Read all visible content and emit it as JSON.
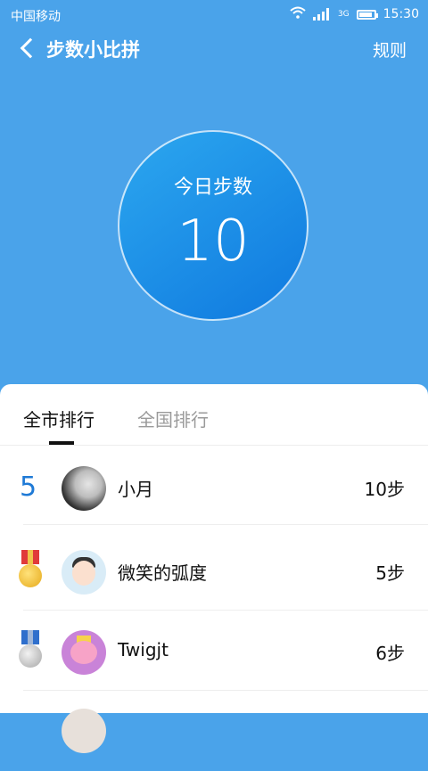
{
  "status_bar": {
    "carrier": "中国移动",
    "network": "3G",
    "time": "15:30"
  },
  "header": {
    "title": "步数小比拼",
    "rules_label": "规则"
  },
  "today": {
    "label": "今日步数",
    "value": "10"
  },
  "tabs": [
    {
      "label": "全市排行",
      "active": true
    },
    {
      "label": "全国排行",
      "active": false
    }
  ],
  "ranking": [
    {
      "rank": "5",
      "name": "小月",
      "steps": "10步",
      "badge": "number"
    },
    {
      "rank": "",
      "name": "微笑的弧度",
      "steps": "5步",
      "badge": "gold-medal"
    },
    {
      "rank": "",
      "name": "Twigjt",
      "steps": "6步",
      "badge": "silver-medal"
    }
  ],
  "colors": {
    "header_bg": "#4aa3ea",
    "accent": "#1f7ad6"
  }
}
